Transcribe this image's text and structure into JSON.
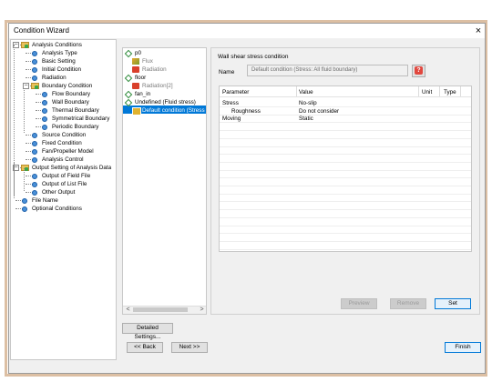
{
  "window": {
    "title": "Condition Wizard",
    "close_glyph": "×"
  },
  "tree": {
    "items": [
      {
        "label": "Analysis Conditions",
        "expander": "−"
      },
      {
        "label": "Analysis Type"
      },
      {
        "label": "Basic Setting"
      },
      {
        "label": "Initial Condition"
      },
      {
        "label": "Radiation"
      },
      {
        "label": "Boundary Condition",
        "expander": "−"
      },
      {
        "label": "Flow Boundary"
      },
      {
        "label": "Wall Boundary"
      },
      {
        "label": "Thermal Boundary"
      },
      {
        "label": "Symmetrical Boundary"
      },
      {
        "label": "Periodic Boundary"
      },
      {
        "label": "Source Condition"
      },
      {
        "label": "Fixed Condition"
      },
      {
        "label": "Fan/Propeller Model"
      },
      {
        "label": "Analysis Control"
      },
      {
        "label": "Output Setting of Analysis Data",
        "expander": "−"
      },
      {
        "label": "Output of Field File"
      },
      {
        "label": "Output of List File"
      },
      {
        "label": "Other Output"
      },
      {
        "label": "File Name"
      },
      {
        "label": "Optional Conditions"
      }
    ]
  },
  "list": {
    "items": [
      {
        "label": "p0",
        "icon": "diamond-icon"
      },
      {
        "label": "Flux",
        "icon": "flux-icon"
      },
      {
        "label": "Radiation",
        "icon": "radiation-icon"
      },
      {
        "label": "floor",
        "icon": "diamond-icon"
      },
      {
        "label": "Radiation[2]",
        "icon": "radiation-icon"
      },
      {
        "label": "fan_in",
        "icon": "diamond-icon"
      },
      {
        "label": "Undefined (Fluid stress)",
        "icon": "diamond-icon"
      },
      {
        "label": "Default condition (Stress",
        "icon": "wall-icon",
        "selected": true
      }
    ],
    "scroll_left": "<",
    "scroll_right": ">"
  },
  "detail": {
    "title": "Wall shear stress condition",
    "name_label": "Name",
    "name_value": "Default condition (Stress: All fluid boundary)",
    "help_glyph": "?",
    "columns": [
      "Parameter",
      "Value",
      "Unit",
      "Type"
    ],
    "rows": [
      [
        "Stress",
        "No-slip",
        "",
        ""
      ],
      [
        "Roughness",
        "Do not consider",
        "",
        ""
      ],
      [
        "Moving",
        "Static",
        "",
        ""
      ]
    ],
    "preview_label": "Preview",
    "remove_label": "Remove",
    "set_label": "Set"
  },
  "footer": {
    "detailed_settings_label": "Detailed Settings...",
    "back_label": "<< Back",
    "next_label": "Next >>",
    "finish_label": "Finish"
  },
  "colors": {
    "selection": "#0078d7",
    "frame": "#c08a57"
  }
}
